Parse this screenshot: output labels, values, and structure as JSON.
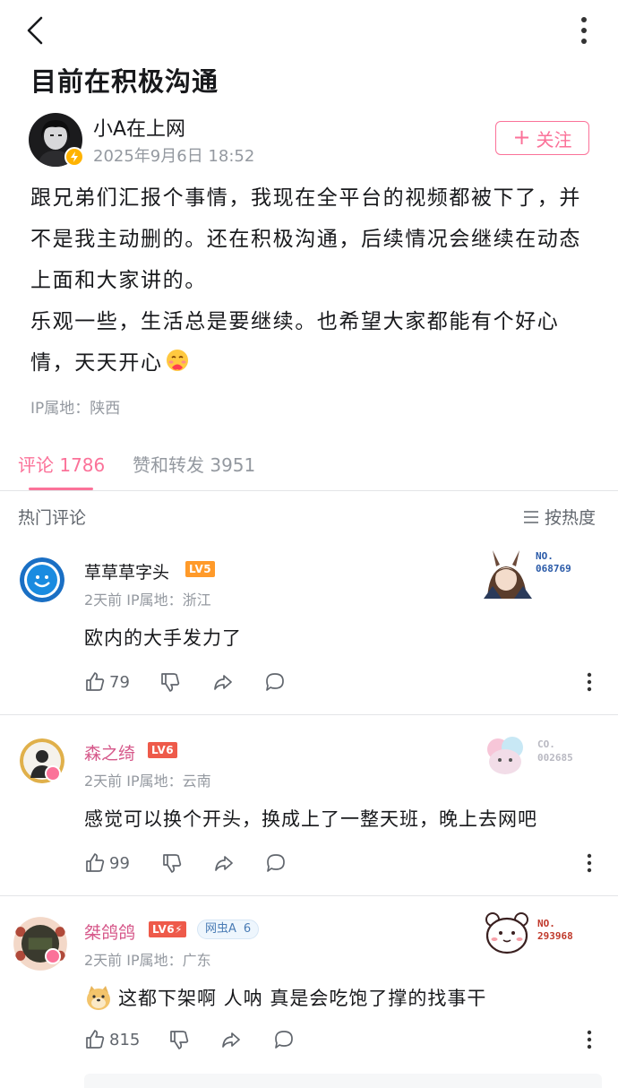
{
  "header": {
    "back_icon": "chevron-left-icon",
    "more_icon": "more-vertical-icon"
  },
  "post": {
    "title": "目前在积极沟通",
    "author": "小A在上网",
    "time": "2025年9月6日 18:52",
    "follow_label": "关注",
    "paragraph1": "跟兄弟们汇报个事情，我现在全平台的视频都被下了，并不是我主动删的。还在积极沟通，后续情况会继续在动态上面和大家讲的。",
    "paragraph2": "乐观一些，生活总是要继续。也希望大家都能有个好心情，天天开心",
    "ip": "IP属地：陕西"
  },
  "tabs": {
    "comments": "评论 1786",
    "likes": "赞和转发 3951"
  },
  "hot": {
    "label": "热门评论",
    "sort": "按热度"
  },
  "comments": [
    {
      "name": "草草草字头",
      "level": "LV5",
      "meta": "2天前  IP属地：浙江",
      "text": "欧内的大手发力了",
      "likes": "79",
      "deco_no1": "NO.",
      "deco_no2": "068769"
    },
    {
      "name": "森之绮",
      "level": "LV6",
      "meta": "2天前  IP属地：云南",
      "text": "感觉可以换个开头，换成上了一整天班，晚上去网吧",
      "likes": "99",
      "deco_no1": "CO.",
      "deco_no2": "002685"
    },
    {
      "name": "桀鸽鸽",
      "level": "LV6⚡",
      "fan_name": "网虫A",
      "fan_level": "6",
      "meta": "2天前  IP属地：广东",
      "text": "这都下架啊 人呐 真是会吃饱了撑的找事干",
      "likes": "815",
      "deco_no1": "NO.",
      "deco_no2": "293968"
    }
  ],
  "colors": {
    "accent": "#fb7299",
    "muted": "#9499a0",
    "lv5": "#ff9a2a",
    "lv6": "#ee5a4a"
  }
}
